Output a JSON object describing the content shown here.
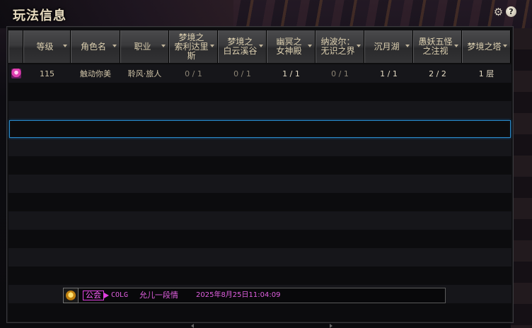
{
  "window": {
    "title": "玩法信息",
    "settings_icon": "gear-icon",
    "help_icon": "help-icon",
    "help_glyph": "?"
  },
  "columns": [
    {
      "label": "等级",
      "width": 66
    },
    {
      "label": "角色名",
      "width": 70
    },
    {
      "label": "职业",
      "width": 69
    },
    {
      "label": "梦境之\n索利达里\n斯",
      "width": 69
    },
    {
      "label": "梦境之\n白云溪谷",
      "width": 69
    },
    {
      "label": "幽冥之\n女神殿",
      "width": 69
    },
    {
      "label": "纳波尔：\n无识之界",
      "width": 69
    },
    {
      "label": "沉月湖",
      "width": 69
    },
    {
      "label": "愚妖五怪\n之注视",
      "width": 69
    },
    {
      "label": "梦境之塔",
      "width": 69
    }
  ],
  "rows": [
    {
      "level": "115",
      "name": "触动你美",
      "class": "聆风·旅人",
      "c1": "0 / 1",
      "c2": "0 / 1",
      "c3": "1 / 1",
      "c4": "0 / 1",
      "c5": "1 / 1",
      "c6": "2 / 2",
      "c7": "1 层"
    }
  ],
  "guild": {
    "tag": "公会",
    "name": "COLG",
    "member": "允儿一段情",
    "timestamp": "2025年8月25日11:04:09"
  },
  "colors": {
    "selection": "#2a88c8",
    "guild_text": "#e060e0",
    "header_text": "#ddd0b0"
  }
}
